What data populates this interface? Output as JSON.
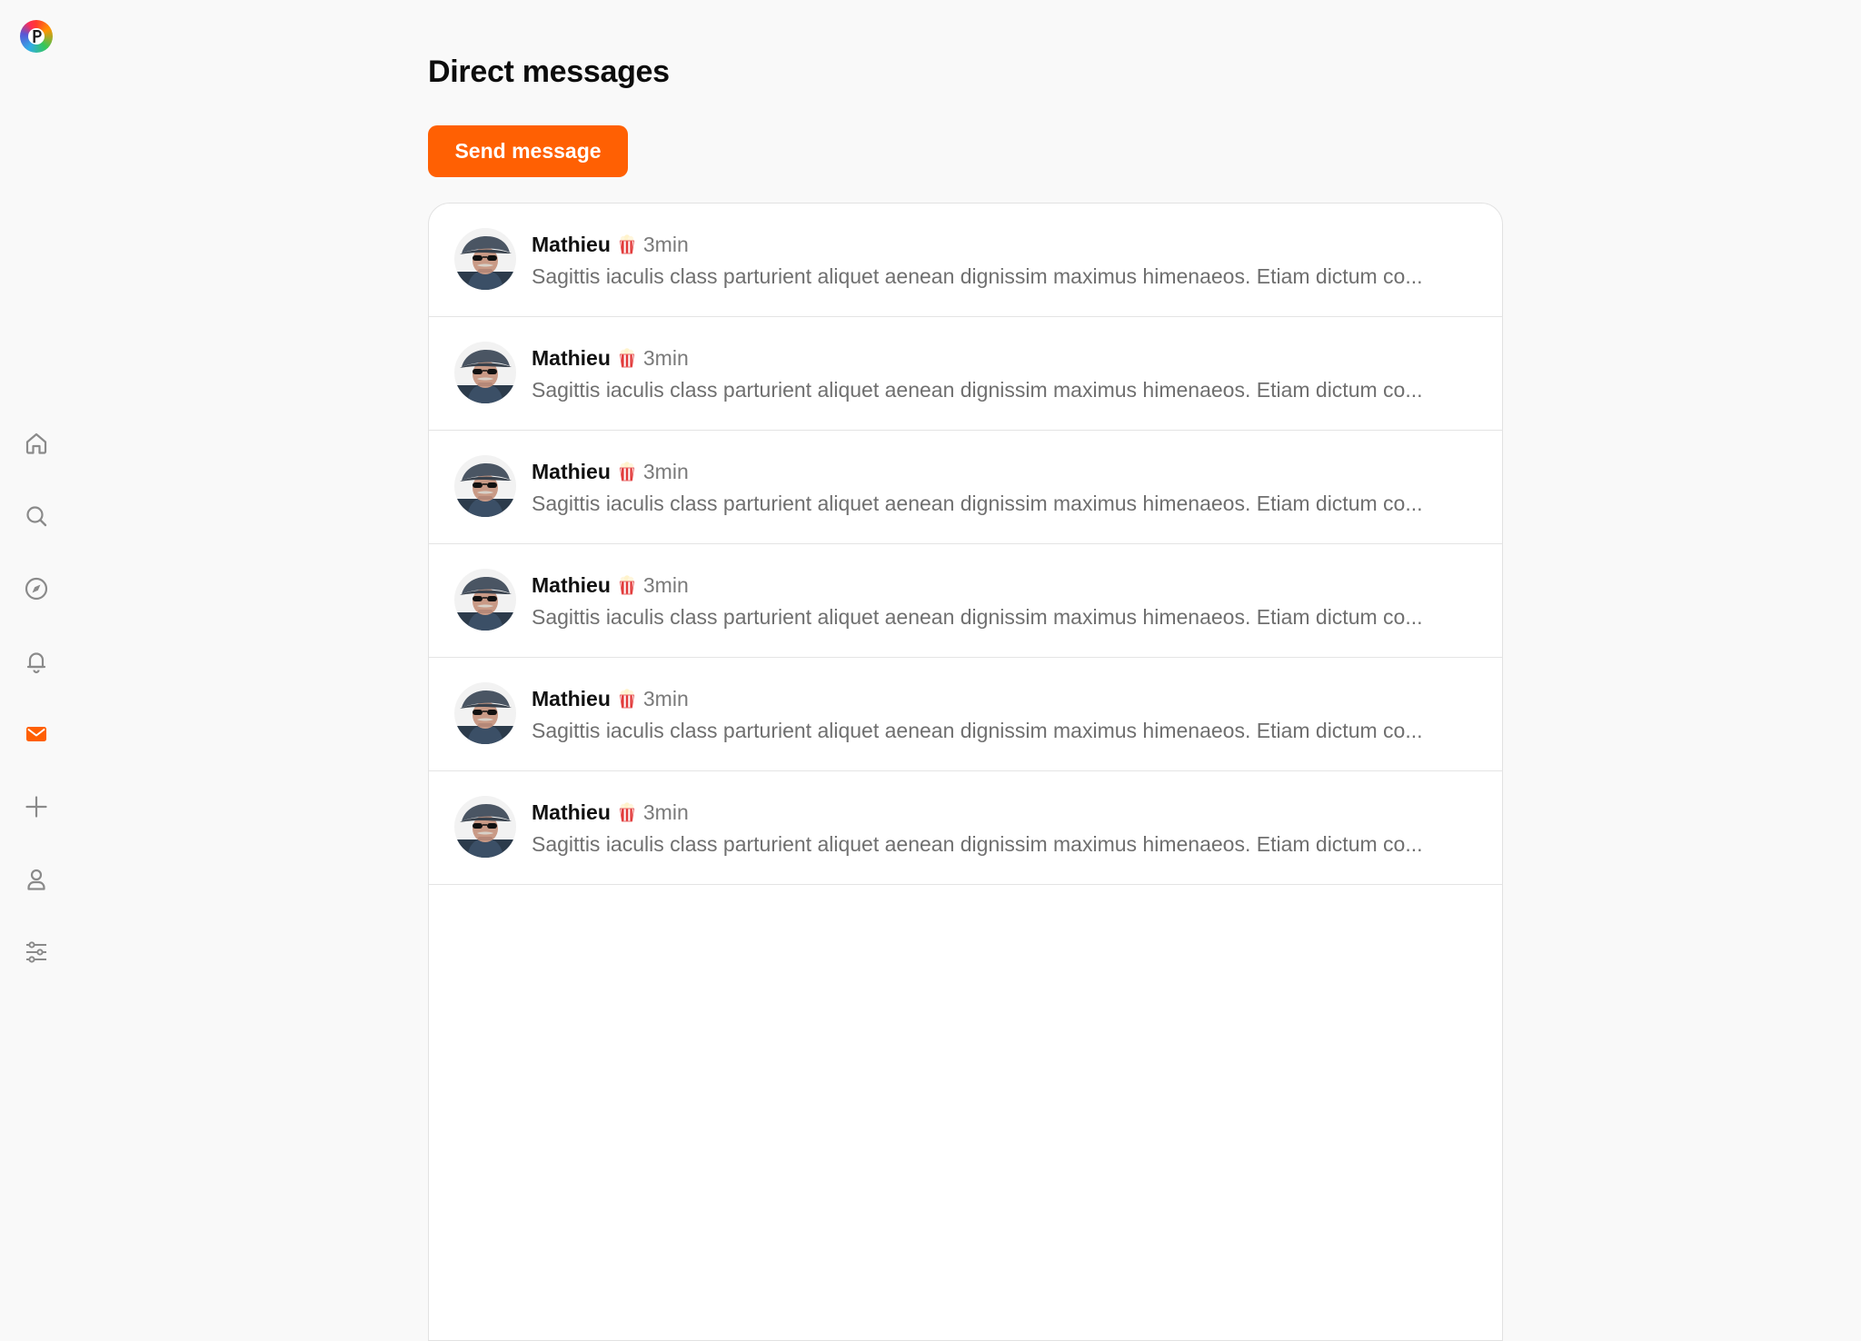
{
  "sidebar": {
    "logo": {
      "icon": "pinned-logo-icon",
      "colors": [
        "#ff3b30",
        "#ff9500",
        "#34c759",
        "#32ade6",
        "#5856d6",
        "#ff2d55"
      ]
    },
    "items": [
      {
        "icon": "home-icon",
        "active": false
      },
      {
        "icon": "search-icon",
        "active": false
      },
      {
        "icon": "explore-compass-icon",
        "active": false
      },
      {
        "icon": "notifications-bell-icon",
        "active": false
      },
      {
        "icon": "messages-envelope-icon",
        "active": true
      },
      {
        "icon": "new-post-plus-icon",
        "active": false
      },
      {
        "icon": "profile-person-icon",
        "active": false
      },
      {
        "icon": "settings-sliders-icon",
        "active": false
      }
    ]
  },
  "main": {
    "title": "Direct messages",
    "send_button_label": "Send message",
    "messages": [
      {
        "sender": "Mathieu",
        "emoji": "popcorn-emoji",
        "time": "3min",
        "preview": "Sagittis iaculis class parturient aliquet aenean dignissim maximus himenaeos. Etiam dictum co..."
      },
      {
        "sender": "Mathieu",
        "emoji": "popcorn-emoji",
        "time": "3min",
        "preview": "Sagittis iaculis class parturient aliquet aenean dignissim maximus himenaeos. Etiam dictum co..."
      },
      {
        "sender": "Mathieu",
        "emoji": "popcorn-emoji",
        "time": "3min",
        "preview": "Sagittis iaculis class parturient aliquet aenean dignissim maximus himenaeos. Etiam dictum co..."
      },
      {
        "sender": "Mathieu",
        "emoji": "popcorn-emoji",
        "time": "3min",
        "preview": "Sagittis iaculis class parturient aliquet aenean dignissim maximus himenaeos. Etiam dictum co..."
      },
      {
        "sender": "Mathieu",
        "emoji": "popcorn-emoji",
        "time": "3min",
        "preview": "Sagittis iaculis class parturient aliquet aenean dignissim maximus himenaeos. Etiam dictum co..."
      },
      {
        "sender": "Mathieu",
        "emoji": "popcorn-emoji",
        "time": "3min",
        "preview": "Sagittis iaculis class parturient aliquet aenean dignissim maximus himenaeos. Etiam dictum co..."
      }
    ]
  },
  "colors": {
    "accent": "#ff6003",
    "icon_gray": "#8a8a8a",
    "background": "#f9f9f9"
  }
}
